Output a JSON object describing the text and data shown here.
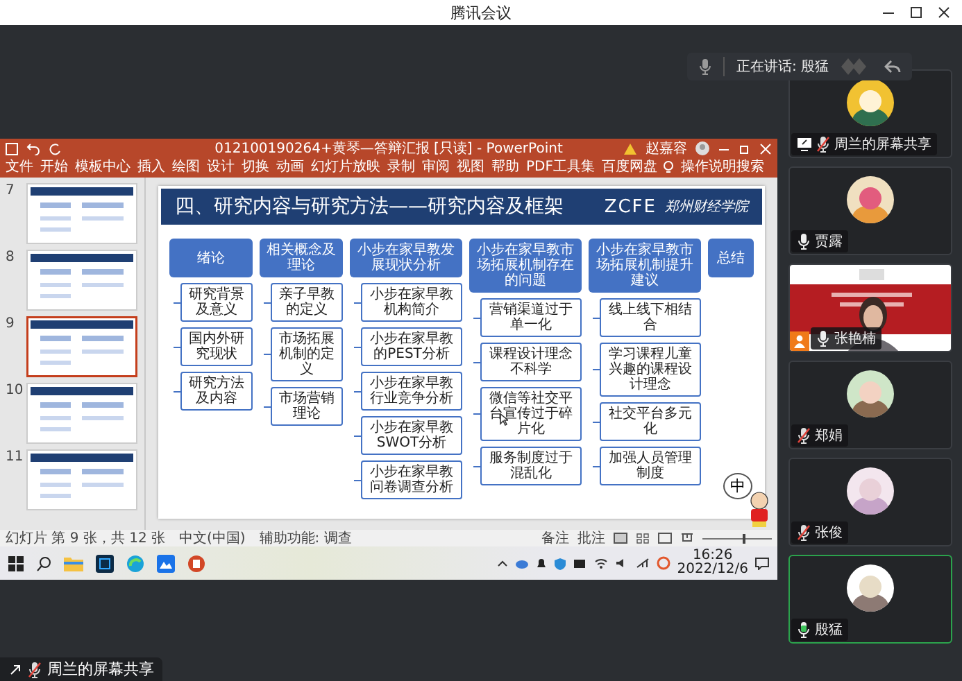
{
  "window": {
    "title": "腾讯会议"
  },
  "speaking": {
    "label": "正在讲话: 殷猛"
  },
  "shared_screen": {
    "powerpoint": {
      "file_title": "012100190264+黄琴—答辩汇报 [只读] - PowerPoint",
      "user": "赵嘉容",
      "ribbon_tabs": [
        "文件",
        "开始",
        "模板中心",
        "插入",
        "绘图",
        "设计",
        "切换",
        "动画",
        "幻灯片放映",
        "录制",
        "审阅",
        "视图",
        "帮助",
        "PDF工具集",
        "百度网盘"
      ],
      "search": "操作说明搜索",
      "thumbnails": [
        {
          "number": "7",
          "selected": false
        },
        {
          "number": "8",
          "selected": false
        },
        {
          "number": "9",
          "selected": true
        },
        {
          "number": "10",
          "selected": false
        },
        {
          "number": "11",
          "selected": false
        }
      ],
      "slide": {
        "title": "四、研究内容与研究方法——研究内容及框架",
        "logo": "ZCFE",
        "school": "郑州财经学院",
        "columns": [
          {
            "heading": "绪论",
            "items": [
              "研究背景及意义",
              "国内外研究现状",
              "研究方法及内容"
            ]
          },
          {
            "heading": "相关概念及理论",
            "items": [
              "亲子早教的定义",
              "市场拓展机制的定义",
              "市场营销理论"
            ]
          },
          {
            "heading": "小步在家早教发展现状分析",
            "items": [
              "小步在家早教机构简介",
              "小步在家早教的PEST分析",
              "小步在家早教行业竞争分析",
              "小步在家早教SWOT分析",
              "小步在家早教问卷调查分析"
            ]
          },
          {
            "heading": "小步在家早教市场拓展机制存在的问题",
            "items": [
              "营销渠道过于单一化",
              "课程设计理念不科学",
              "微信等社交平台宣传过于碎片化",
              "服务制度过于混乱化"
            ]
          },
          {
            "heading": "小步在家早教市场拓展机制提升建议",
            "items": [
              "线上线下相结合",
              "学习课程儿童兴趣的课程设计理念",
              "社交平台多元化",
              "加强人员管理制度"
            ]
          },
          {
            "heading": "总结"
          }
        ]
      },
      "ime": "中",
      "status_bar": {
        "slide_info": "幻灯片 第 9 张，共 12 张",
        "language": "中文(中国)",
        "accessibility": "辅助功能: 调查",
        "notes": "备注",
        "comments": "批注",
        "zoom": {
          "level": 0.6
        }
      }
    },
    "taskbar": {
      "time": "16:26",
      "date": "2022/12/6"
    }
  },
  "participants": [
    {
      "name": "周兰的屏幕共享",
      "kind": "avatar",
      "muted": true,
      "speaking": false,
      "sharing": true,
      "host": false
    },
    {
      "name": "贾露",
      "kind": "avatar",
      "muted": false,
      "speaking": false,
      "sharing": false,
      "host": false
    },
    {
      "name": "张艳楠",
      "kind": "video",
      "muted": false,
      "speaking": false,
      "sharing": false,
      "host": true
    },
    {
      "name": "郑娟",
      "kind": "avatar",
      "muted": true,
      "speaking": false,
      "sharing": false,
      "host": false
    },
    {
      "name": "张俊",
      "kind": "avatar",
      "muted": true,
      "speaking": false,
      "sharing": false,
      "host": false
    },
    {
      "name": "殷猛",
      "kind": "avatar",
      "muted": false,
      "speaking": true,
      "sharing": false,
      "host": false
    }
  ],
  "share_label": {
    "name": "周兰的屏幕共享",
    "muted": true
  }
}
